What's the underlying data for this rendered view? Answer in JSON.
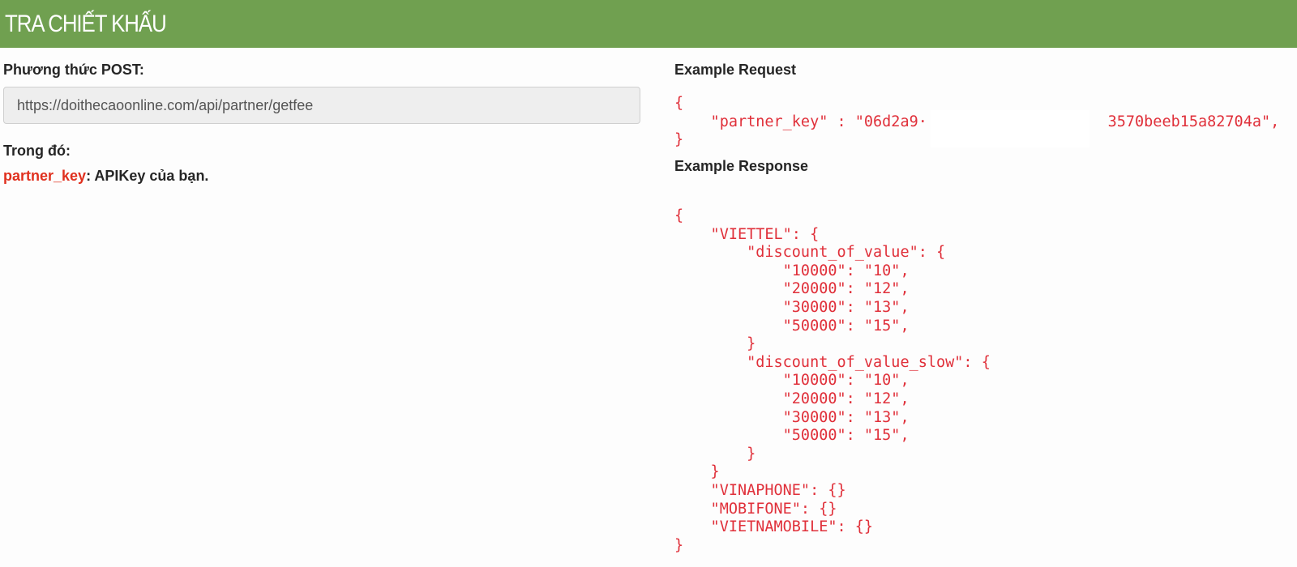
{
  "header": {
    "title": "TRA CHIẾT KHẤU"
  },
  "left": {
    "method_label": "Phương thức POST:",
    "url": "https://doithecaoonline.com/api/partner/getfee",
    "where_label": "Trong đó:",
    "param_key": "partner_key",
    "param_desc": ": APIKey của bạn."
  },
  "right": {
    "request_title": "Example Request",
    "request_body": "{\n    \"partner_key\" : \"06d2a9·                    3570beeb15a82704a\",\n}",
    "response_title": "Example Response",
    "response_body": "{\n    \"VIETTEL\": {\n        \"discount_of_value\": {\n            \"10000\": \"10\",\n            \"20000\": \"12\",\n            \"30000\": \"13\",\n            \"50000\": \"15\",\n        }\n        \"discount_of_value_slow\": {\n            \"10000\": \"10\",\n            \"20000\": \"12\",\n            \"30000\": \"13\",\n            \"50000\": \"15\",\n        }\n    }\n    \"VINAPHONE\": {}\n    \"MOBIFONE\": {}\n    \"VIETNAMOBILE\": {}\n}"
  },
  "colors": {
    "header_bg": "#70a050",
    "code_text": "#e0303a",
    "param_key": "#e0301e"
  }
}
